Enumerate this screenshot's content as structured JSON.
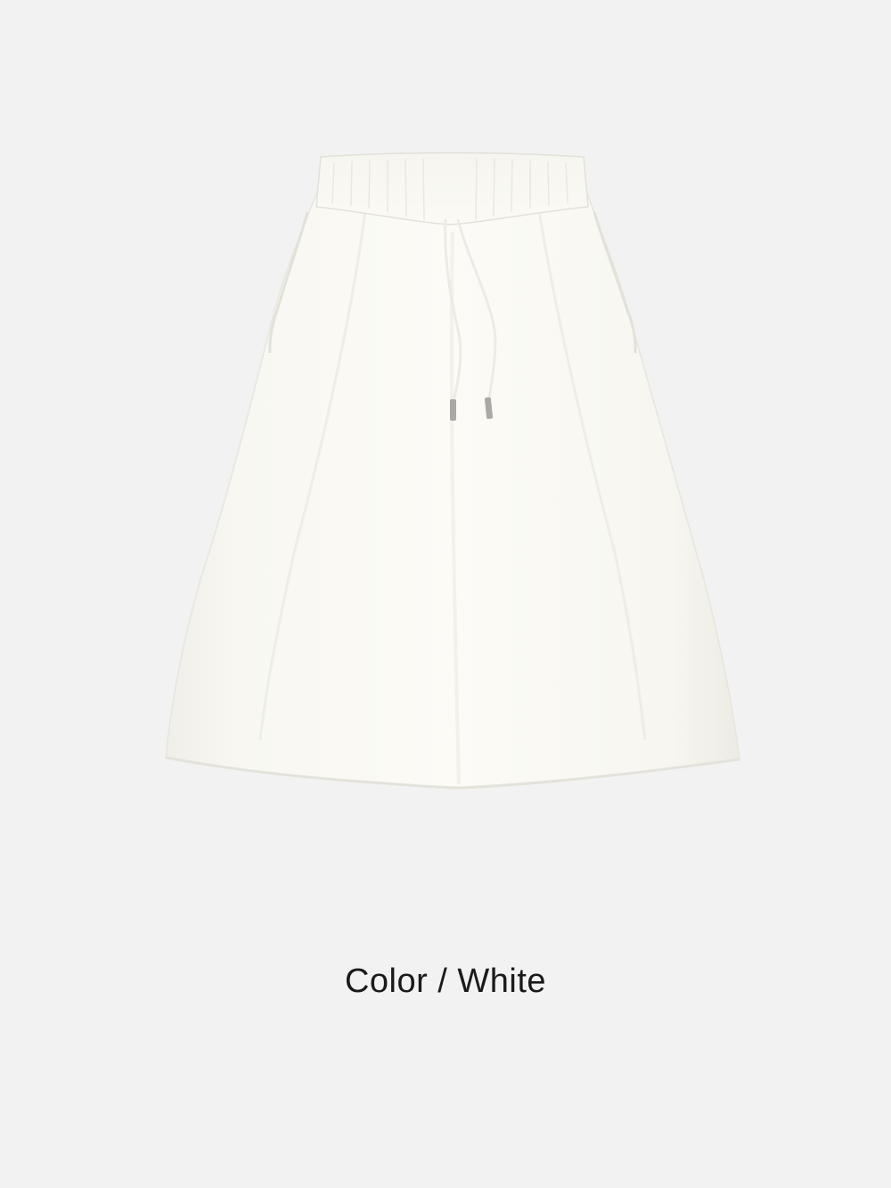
{
  "product": {
    "image_subject": "skirt",
    "garment_color": "#fbfaf4",
    "background_color": "#f2f2f2"
  },
  "caption": {
    "text": "Color / White"
  }
}
